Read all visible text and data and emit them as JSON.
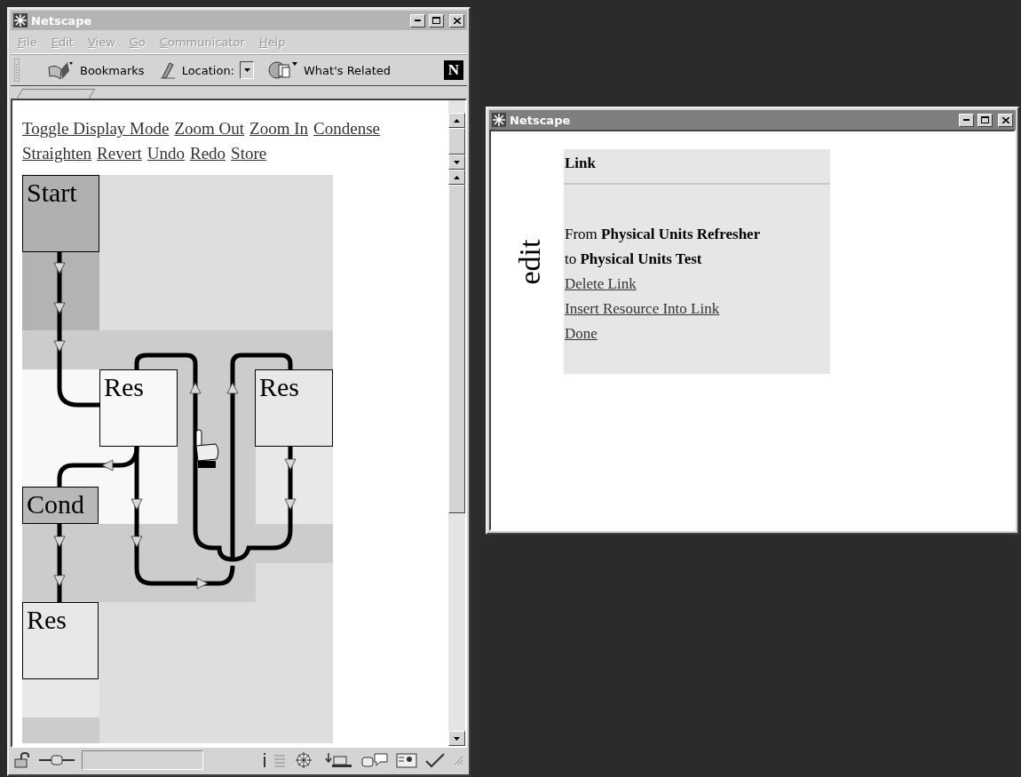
{
  "browser_window": {
    "title": "Netscape",
    "active": false,
    "menu": [
      {
        "label": "File",
        "disabled": true
      },
      {
        "label": "Edit",
        "disabled": true
      },
      {
        "label": "View",
        "disabled": true
      },
      {
        "label": "Go",
        "disabled": true
      },
      {
        "label": "Communicator",
        "disabled": true
      },
      {
        "label": "Help",
        "disabled": true
      }
    ],
    "toolbar": {
      "items": [
        "Bookmarks",
        "Location:",
        "What's Related"
      ],
      "logo": "N"
    },
    "links": [
      "Toggle Display Mode",
      "Zoom Out",
      "Zoom In",
      "Condense",
      "Straighten",
      "Revert",
      "Undo",
      "Redo",
      "Store"
    ],
    "diagram": {
      "nodes": [
        {
          "label": "Start",
          "color": "#b0b0b0"
        },
        {
          "label": "Res",
          "color": "#f8f8f8"
        },
        {
          "label": "Res",
          "color": "#e8e8e8"
        },
        {
          "label": "Cond",
          "color": "#b8b8b8"
        },
        {
          "label": "Res",
          "color": "#e8e8e8"
        }
      ]
    }
  },
  "popup_window": {
    "title": "Netscape",
    "active": true,
    "side_label": "edit",
    "panel": {
      "heading": "Link",
      "lines": [
        "From **Physical Units Refresher**",
        "to **Physical Units Test**"
      ],
      "links": [
        "Delete Link",
        "Insert Resource Into Link",
        "Done"
      ]
    }
  }
}
